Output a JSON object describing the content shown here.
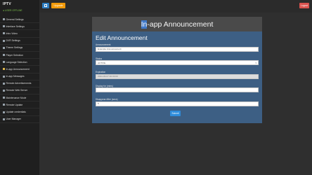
{
  "app": {
    "brand": "IPTV",
    "status": "● USER OFFLINE"
  },
  "topbar": {
    "orange_label": "Upgrade",
    "logout_label": "Logout"
  },
  "sidebar": {
    "items": [
      {
        "label": "General Settings",
        "icon": "gear-icon",
        "color": "#9aa4ad"
      },
      {
        "label": "Interface Settings",
        "icon": "monitor-icon",
        "color": "#9aa4ad"
      },
      {
        "label": "Intro Video",
        "icon": "video-icon",
        "color": "#9aa4ad"
      },
      {
        "label": "DVR Settings",
        "icon": "record-icon",
        "color": "#9aa4ad"
      },
      {
        "label": "Theme Settings",
        "icon": "palette-icon",
        "color": "#9aa4ad"
      },
      {
        "label": "Player Selection",
        "icon": "play-icon",
        "color": "#9aa4ad"
      },
      {
        "label": "Language Selection",
        "icon": "globe-icon",
        "color": "#9aa4ad"
      },
      {
        "label": "In-app Announcement",
        "icon": "bullhorn-icon",
        "color": "#e0b84a"
      },
      {
        "label": "In-app Messages",
        "icon": "message-icon",
        "color": "#9aa4ad"
      },
      {
        "label": "Remote Advertisements",
        "icon": "ads-icon",
        "color": "#9aa4ad"
      },
      {
        "label": "Remote Web Server",
        "icon": "server-icon",
        "color": "#9aa4ad"
      },
      {
        "label": "Maintenance Mode",
        "icon": "wrench-icon",
        "color": "#9aa4ad"
      },
      {
        "label": "Remote Update",
        "icon": "update-icon",
        "color": "#9aa4ad"
      },
      {
        "label": "Update credentials",
        "icon": "key-icon",
        "color": "#9aa4ad"
      },
      {
        "label": "User Manager",
        "icon": "users-icon",
        "color": "#9aa4ad"
      }
    ]
  },
  "panel": {
    "title_highlight": "In",
    "title_rest": "-app Announcement",
    "form_heading": "Edit Announcement",
    "fields": {
      "announcement": {
        "label": "Announcement",
        "value": "Example Announcement"
      },
      "status": {
        "label": "Status",
        "value": "ACTIVE"
      },
      "expiration": {
        "label": "Expiration",
        "value": "2024-09-07 00:00:00"
      },
      "display_for": {
        "label": "Display for (mins)",
        "value": ""
      },
      "disappear_after": {
        "label": "Disappear After (secs)",
        "value": "5"
      }
    },
    "submit_label": "Submit"
  },
  "colors": {
    "panel": "#3d5f84",
    "header": "#4a4a4a",
    "submit": "#2f8ddb",
    "upgrade": "#f29a0a",
    "logout": "#d9534f"
  }
}
